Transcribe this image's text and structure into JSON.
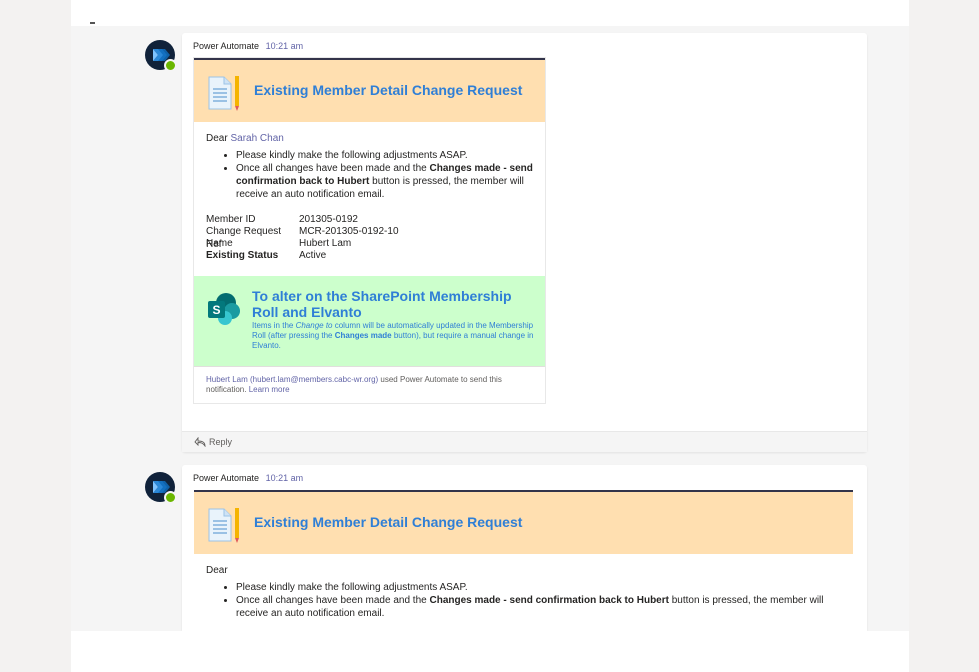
{
  "messages": [
    {
      "sender": "Power Automate",
      "time": "10:21 am",
      "card": {
        "title": "Existing Member Detail Change Request",
        "dear": "Dear",
        "dear_name": "Sarah Chan",
        "bullet1": "Please kindly make the following adjustments ASAP.",
        "bullet2_pre": "Once all changes have been made and the ",
        "bullet2_bold": "Changes made - send confirmation back to Hubert",
        "bullet2_post": " button is pressed, the member will receive an auto notification email.",
        "facts": [
          {
            "label": "Member ID",
            "value": "201305-0192"
          },
          {
            "label": "Change Request Ref",
            "value": "MCR-201305-0192-10"
          },
          {
            "label": "Name",
            "value": "Hubert Lam"
          },
          {
            "label": "Existing Status",
            "value": "Active"
          }
        ],
        "sp_title": "To alter on the SharePoint Membership Roll and Elvanto",
        "sp_desc_1": "Items in the ",
        "sp_desc_em": "Change to",
        "sp_desc_2": " column will be automatically updated in the Membership Roll (after pressing the ",
        "sp_desc_b": "Changes made",
        "sp_desc_3": " button), but require a manual change in Elvanto.",
        "footer_link": "Hubert Lam (hubert.lam@members.cabc-wr.org)",
        "footer_text": " used Power Automate to send this notification. ",
        "footer_learn": "Learn more"
      },
      "reply_label": "Reply"
    },
    {
      "sender": "Power Automate",
      "time": "10:21 am",
      "card": {
        "title": "Existing Member Detail Change Request",
        "dear": "Dear",
        "bullet1": "Please kindly make the following adjustments ASAP.",
        "bullet2_pre": "Once all changes have been made and the ",
        "bullet2_bold": "Changes made - send confirmation back to Hubert",
        "bullet2_post": " button is pressed, the member will receive an auto notification email."
      }
    }
  ],
  "colors": {
    "accent": "#6264a7",
    "title_blue": "#2f7fd6",
    "header_orange": "#ffdfb0",
    "sharepoint_green": "#ccffcc",
    "presence_green": "#6bb700"
  },
  "icons": {
    "avatar": "power-automate-icon",
    "card": "document-pencil-icon",
    "sharepoint": "sharepoint-icon",
    "reply": "reply-arrow-icon"
  }
}
